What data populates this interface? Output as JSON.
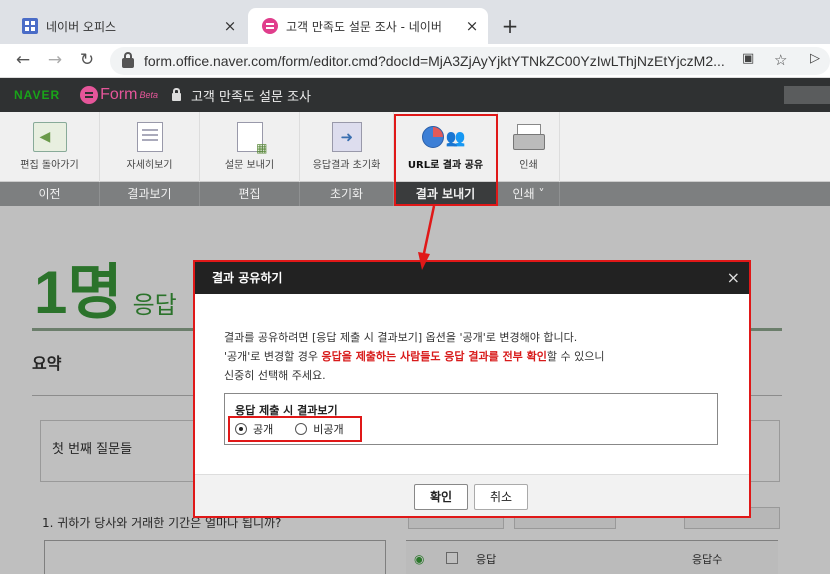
{
  "browser": {
    "tabs": [
      {
        "title": "네이버 오피스",
        "icon": "naver-office-grid-icon"
      },
      {
        "title": "고객 만족도 설문 조사 - 네이버",
        "icon": "naver-form-icon"
      }
    ],
    "close_glyph": "×",
    "new_tab_glyph": "+",
    "back_glyph": "←",
    "forward_glyph": "→",
    "reload_glyph": "↻",
    "url": "form.office.naver.com/form/editor.cmd?docId=MjA3ZjAyYjktYTNkZC00YzIwLThjNzEtYjczM2...",
    "star_glyph": "☆"
  },
  "app": {
    "naver_logo": "NAVER",
    "form_logo": "Form",
    "form_badge": "Beta",
    "doc_title": "고객 만족도 설문 조사"
  },
  "toolbar": {
    "items": [
      {
        "label": "편집 돌아가기"
      },
      {
        "label": "자세히보기"
      },
      {
        "label": "설문 보내기"
      },
      {
        "label": "응답결과 초기화"
      },
      {
        "label": "URL로 결과 공유"
      },
      {
        "label": "인쇄"
      }
    ],
    "categories": [
      {
        "label": "이전"
      },
      {
        "label": "결과보기"
      },
      {
        "label": "편집"
      },
      {
        "label": "초기화"
      },
      {
        "label": "결과 보내기"
      },
      {
        "label": "인쇄 ˅"
      }
    ]
  },
  "page": {
    "count": "1명",
    "count_suffix": "응답",
    "summary_label": "요약",
    "first_question": "첫 번째 질문들",
    "question1": "1. 귀하가 당사와 거래한 기간은 얼마나 됩니까?",
    "col_response": "응답",
    "col_count": "응답수"
  },
  "modal": {
    "title": "결과 공유하기",
    "close": "×",
    "line1": "결과를 공유하려면 [응답 제출 시 결과보기] 옵션을 '공개'로 변경해야 합니다.",
    "line2_pre": "'공개'로 변경할 경우 ",
    "line2_highlight": "응답을 제출하는 사람들도 응답 결과를 전부 확인",
    "line2_post": "할 수 있으니",
    "line3": "신중히 선택해 주세요.",
    "option_title": "응답 제출 시 결과보기",
    "option_public": "공개",
    "option_private": "비공개",
    "selected": "공개",
    "confirm": "확인",
    "cancel": "취소"
  },
  "colors": {
    "annotation_red": "#e01818",
    "naver_green": "#19a319",
    "form_pink": "#e6569a",
    "highlight_red": "#d81b1b"
  }
}
